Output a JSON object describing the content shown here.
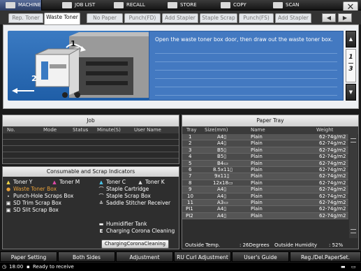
{
  "top_tabs": [
    {
      "label": "MACHINE",
      "active": true
    },
    {
      "label": "JOB LIST",
      "active": false
    },
    {
      "label": "RECALL",
      "active": false
    },
    {
      "label": "STORE",
      "active": false
    },
    {
      "label": "COPY",
      "active": false
    },
    {
      "label": "SCAN",
      "active": false
    }
  ],
  "close_label": "✕",
  "indicator_tabs": [
    "Rep. Toner",
    "Waste Toner",
    "No Paper",
    "Punch(FD)",
    "Add Stapler",
    "Staple Scrap",
    "Punch(FS)",
    "Add Stapler"
  ],
  "tab_nav": {
    "prev": "◀",
    "next": "▶"
  },
  "message": "Open the waste toner box door, then draw out the waste toner box.",
  "illustration": {
    "step1": "1",
    "step2": "2"
  },
  "pager": {
    "up": "▲",
    "page": "1",
    "total": "3",
    "down": "▼"
  },
  "job": {
    "title": "Job",
    "columns": {
      "no": "No.",
      "mode": "Mode",
      "status": "Status",
      "minutes": "Minute(S)",
      "user": "User Name"
    }
  },
  "consumables": {
    "title": "Consumable and Scrap Indicators",
    "items": {
      "toner_y": "Toner Y",
      "toner_m": "Toner M",
      "toner_c": "Toner C",
      "toner_k": "Toner K",
      "waste_toner": "Waste Toner Box",
      "staple_cartridge": "Staple Cartridge",
      "punch_hole": "Punch-Hole Scraps Box",
      "staple_scrap": "Staple Scrap Box",
      "sd_trim": "SD Trim Scrap Box",
      "saddle_stitcher": "Saddle Stitcher Receiver",
      "sd_slit": "SD Slit Scrap Box",
      "humidifier": "Humidifier Tank",
      "charging_corona": "Charging Corona Cleaning"
    },
    "button": "ChargingCoronaCleaning"
  },
  "tray": {
    "title": "Paper Tray",
    "columns": {
      "tray": "Tray",
      "size": "Size(mm)",
      "name": "Name",
      "weight": "Weight"
    },
    "rows": [
      {
        "tray": "1",
        "size": "A4▯",
        "name": "Plain",
        "weight": "62-74g/m2"
      },
      {
        "tray": "2",
        "size": "A4▯",
        "name": "Plain",
        "weight": "62-74g/m2"
      },
      {
        "tray": "3",
        "size": "B5▯",
        "name": "Plain",
        "weight": "62-74g/m2"
      },
      {
        "tray": "4",
        "size": "B5▯",
        "name": "Plain",
        "weight": "62-74g/m2"
      },
      {
        "tray": "5",
        "size": "B4▭",
        "name": "Plain",
        "weight": "62-74g/m2"
      },
      {
        "tray": "6",
        "size": "8.5x11▯",
        "name": "Plain",
        "weight": "62-74g/m2"
      },
      {
        "tray": "7",
        "size": "9x11▯",
        "name": "Plain",
        "weight": "62-74g/m2"
      },
      {
        "tray": "8",
        "size": "12x18▭",
        "name": "Plain",
        "weight": "62-74g/m2"
      },
      {
        "tray": "9",
        "size": "A4▯",
        "name": "Plain",
        "weight": "62-74g/m2"
      },
      {
        "tray": "10",
        "size": "A4▯",
        "name": "Plain",
        "weight": "62-74g/m2"
      },
      {
        "tray": "11",
        "size": "A3▭",
        "name": "Plain",
        "weight": "62-74g/m2"
      },
      {
        "tray": "PI1",
        "size": "A4▯",
        "name": "Plain",
        "weight": "62-74g/m2"
      },
      {
        "tray": "PI2",
        "size": "A4▯",
        "name": "Plain",
        "weight": "62-74g/m2"
      }
    ],
    "outside_temp_label": "Outside Temp.",
    "outside_temp_value": ": 26Degrees",
    "outside_humidity_label": "Outside Humidity",
    "outside_humidity_value": ": 52%"
  },
  "bottom_buttons": [
    "Paper Setting",
    "Both Sides",
    "Adjustment",
    "RU Curl Adjustment",
    "User's Guide",
    "Reg./Del.PaperSet."
  ],
  "status": {
    "time": "18:00",
    "text": "Ready to receive"
  },
  "colors": {
    "accent_blue": "#4379c1",
    "alert_orange": "#e8a13a",
    "active_tab": "#3a4e7a"
  }
}
